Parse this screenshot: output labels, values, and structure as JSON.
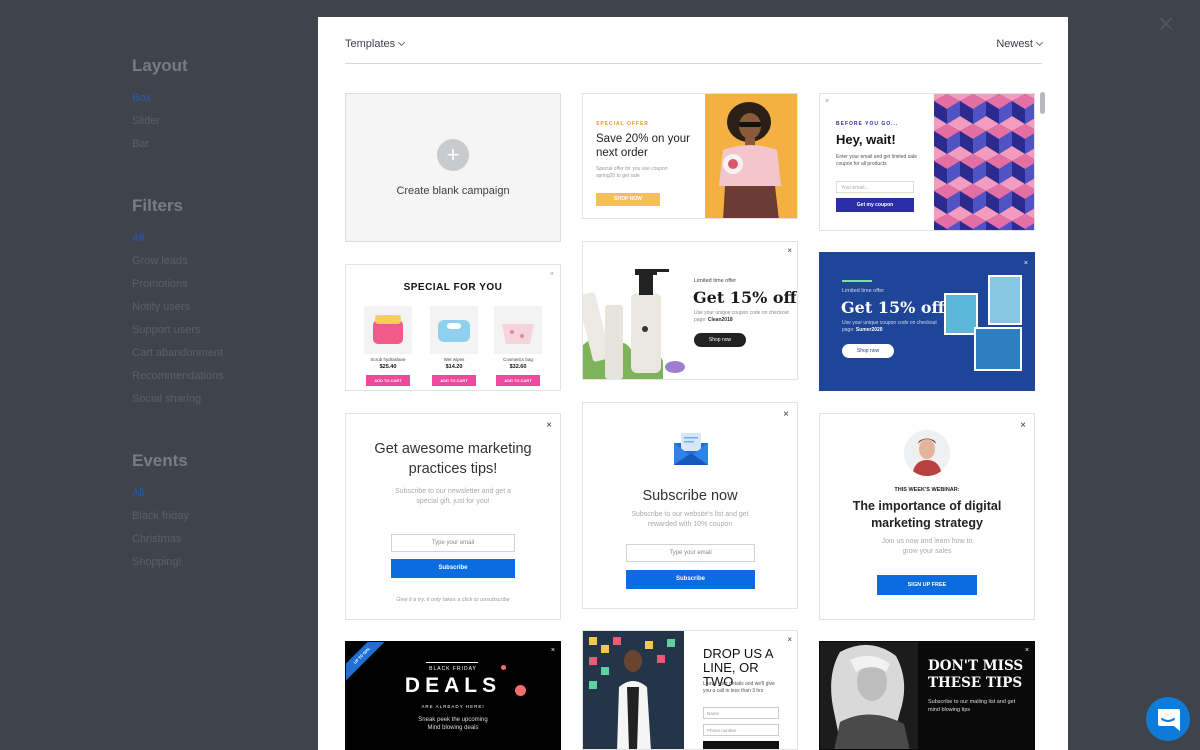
{
  "sidebar": {
    "layout": {
      "title": "Layout",
      "items": [
        "Box",
        "Slider",
        "Bar"
      ]
    },
    "filters": {
      "title": "Filters",
      "items": [
        "All",
        "Grow leads",
        "Promotions",
        "Notify users",
        "Support users",
        "Cart abandonment",
        "Recommendations",
        "Social sharing"
      ]
    },
    "events": {
      "title": "Events",
      "items": [
        "All",
        "Black friday",
        "Christmas",
        "Shopping!"
      ]
    }
  },
  "modal": {
    "templates_label": "Templates",
    "sort_label": "Newest"
  },
  "blank": {
    "label": "Create blank campaign"
  },
  "card_offer": {
    "eyebrow": "SPECIAL OFFER",
    "title": "Save 20% on your next order",
    "text": "Special offer for you use coupon spring20 to get sale",
    "button": "SHOP NOW"
  },
  "card_wait": {
    "eyebrow": "BEFORE YOU GO...",
    "title": "Hey, wait!",
    "text": "Enter your email and get limited sale coupon for all products",
    "placeholder": "Your email...",
    "button": "Get my coupon"
  },
  "card_special": {
    "title": "SPECIAL FOR YOU",
    "products": [
      {
        "name": "Scrub hydraslane",
        "price": "$25.40",
        "button": "ADD TO CART"
      },
      {
        "name": "Wet wipes",
        "price": "$14.20",
        "button": "ADD TO CART"
      },
      {
        "name": "Cosmetics bag",
        "price": "$32.60",
        "button": "ADD TO CART"
      }
    ]
  },
  "card_15a": {
    "eyebrow": "Limited time offer",
    "title": "Get 15% off",
    "text": "Use your unique coupon code on checkout page: ",
    "code": "Clean2018",
    "button": "Shop now"
  },
  "card_15b": {
    "eyebrow": "Limited time offer",
    "title": "Get 15% off",
    "text": "Use your unique coupon code on checkout page: ",
    "code": "Sumer2020",
    "button": "Shop now"
  },
  "card_tips": {
    "title": "Get awesome marketing practices tips!",
    "text": "Subscribe to our newsletter and get a special gift, just for you!",
    "placeholder": "Type your email",
    "button": "Subscribe",
    "footer": "Give it a try, it only takes a click to unsubscribe"
  },
  "card_subscribe": {
    "title": "Subscribe now",
    "text": "Subscribe to our website's list and get rewarded with 10% coupon",
    "placeholder": "Type your email",
    "button": "Subscribe"
  },
  "card_webinar": {
    "eyebrow": "THIS WEEK'S WEBINAR:",
    "title": "The importance of digital marketing strategy",
    "text": "Join us now and learn how to grow your sales",
    "button": "SIGN UP FREE"
  },
  "card_bf": {
    "ribbon": "UP TO 50%",
    "eyebrow": "BLACK FRIDAY",
    "title": "DEALS",
    "sub": "ARE ALREADY HERE!",
    "text": "Sneak peek the upcoming Mind blowing deals"
  },
  "card_drop": {
    "title": "DROP US A LINE, OR TWO",
    "text": "Leave your details and we'll give you a call in less than 3 hrs",
    "name_placeholder": "Name",
    "phone_placeholder": "Phone number"
  },
  "card_miss": {
    "title": "DON'T MISS THESE TIPS",
    "text": "Subscribe to our mailing list and get mind blowing tips"
  },
  "colors": {
    "accent": "#0b6ce0",
    "navy": "#2b2ea6",
    "blueCard": "#1e4597",
    "pink": "#f0489c",
    "orange": "#f5bf5b"
  }
}
